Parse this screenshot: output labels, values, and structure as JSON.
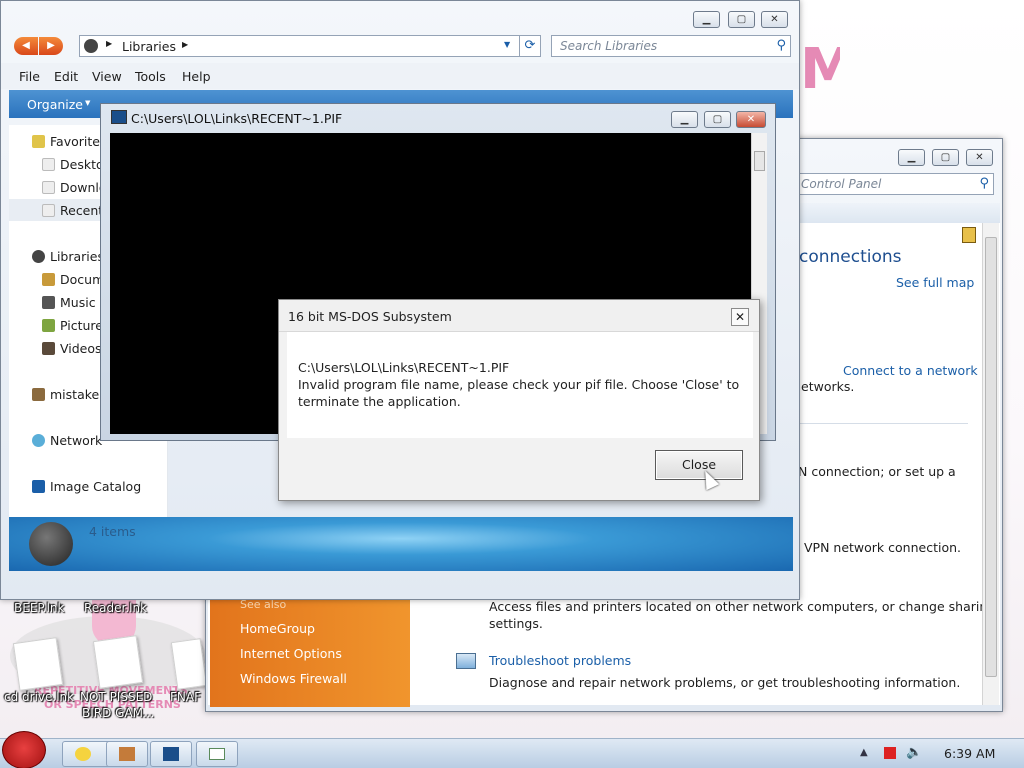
{
  "libraries": {
    "breadcrumb": "Libraries",
    "search_placeholder": "Search Libraries",
    "menu": [
      "File",
      "Edit",
      "View",
      "Tools",
      "Help"
    ],
    "organize": "Organize",
    "nav": {
      "favorites": "Favorites",
      "desktop": "Deskto",
      "downloads": "Downlo",
      "recent": "Recentl",
      "libraries": "Libraries",
      "documents": "Docum",
      "music": "Music",
      "pictures": "Pictures",
      "videos": "Videos",
      "mistake": "mistake",
      "network": "Network",
      "image_catalog": "Image Catalog"
    },
    "status": "4 items"
  },
  "control_panel": {
    "search_placeholder": "Control Panel",
    "heading": "connections",
    "see_full_map": "See full map",
    "connect_to_network": "Connect to a network",
    "networks_text": "etworks.",
    "setup_text": "N connection; or set up a",
    "vpn_text": "VPN network connection.",
    "access_text_1": "Access files and printers located on other network computers, or change sharing",
    "access_text_2": "settings.",
    "troubleshoot_link": "Troubleshoot problems",
    "troubleshoot_desc": "Diagnose and repair network problems, or get troubleshooting information.",
    "see_also": "See also",
    "left_links": [
      "HomeGroup",
      "Internet Options",
      "Windows Firewall"
    ]
  },
  "cmd_window": {
    "title": "C:\\Users\\LOL\\Links\\RECENT~1.PIF"
  },
  "dialog": {
    "title": "16 bit MS-DOS Subsystem",
    "line1": "C:\\Users\\LOL\\Links\\RECENT~1.PIF",
    "line2": "Invalid program file name, please check your pif file. Choose 'Close' to",
    "line3": "terminate the application.",
    "close_button": "Close"
  },
  "desktop": {
    "icons": [
      {
        "label": "BEEP.lnk"
      },
      {
        "label": "Reader.lnk"
      },
      {
        "label": "cd drive.lnk"
      },
      {
        "label": "NOT PISSED"
      },
      {
        "label": "FNAF"
      }
    ],
    "wallpaper_text_1": "REPETITIVE MOVEMENTS",
    "wallpaper_text_2": "OR SPEECH PATTERNS",
    "bird_game": "BIRD GAM..."
  },
  "taskbar": {
    "time": "6:39 AM"
  },
  "colors": {
    "accent_blue": "#2a72bd",
    "cp_orange": "#e9831f",
    "link": "#1b5fa8",
    "close_red": "#c74b33"
  }
}
